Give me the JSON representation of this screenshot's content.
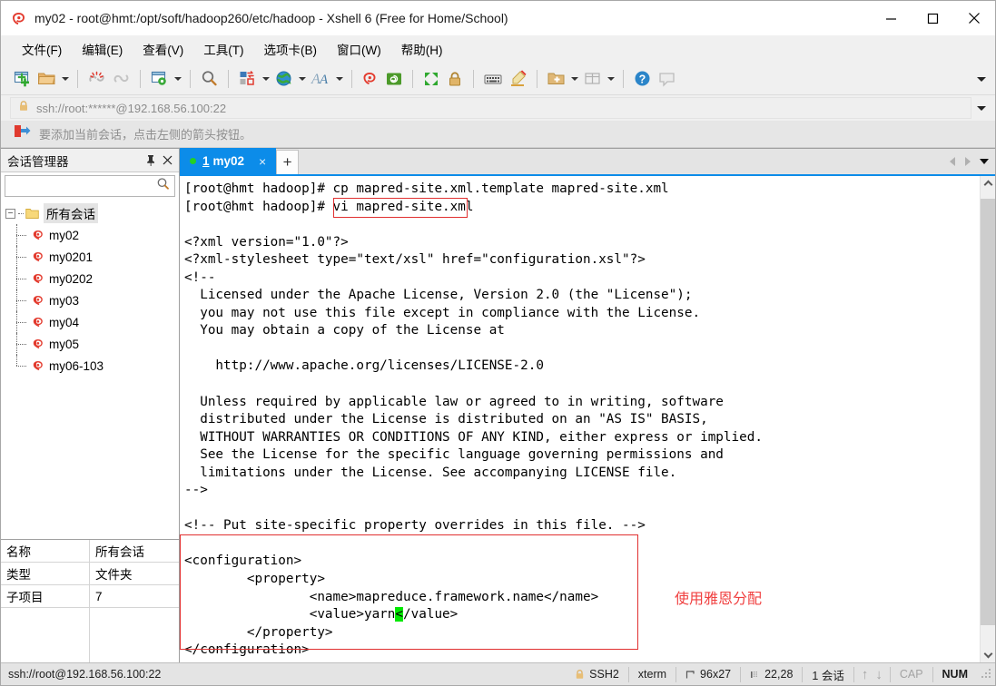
{
  "window": {
    "title": "my02 - root@hmt:/opt/soft/hadoop260/etc/hadoop - Xshell 6 (Free for Home/School)",
    "app_icon": "xshell-logo-icon",
    "minimize_label": "Minimize",
    "maximize_label": "Maximize",
    "close_label": "Close"
  },
  "menubar": {
    "items": [
      {
        "label": "文件(F)"
      },
      {
        "label": "编辑(E)"
      },
      {
        "label": "查看(V)"
      },
      {
        "label": "工具(T)"
      },
      {
        "label": "选项卡(B)"
      },
      {
        "label": "窗口(W)"
      },
      {
        "label": "帮助(H)"
      }
    ]
  },
  "toolbar": {
    "overflow_label": "More toolbar buttons",
    "items": [
      {
        "name": "new-session-icon",
        "caret": false
      },
      {
        "name": "open-folder-icon",
        "caret": true
      },
      {
        "name": "disconnect-icon",
        "caret": false
      },
      {
        "name": "reconnect-icon",
        "caret": false
      },
      {
        "name": "session-properties-icon",
        "caret": true
      },
      {
        "name": "find-icon",
        "caret": false
      },
      {
        "name": "transfer-file-icon",
        "caret": true
      },
      {
        "name": "globe-icon",
        "caret": true
      },
      {
        "name": "font-icon",
        "caret": true
      },
      {
        "name": "xshell-icon",
        "caret": false
      },
      {
        "name": "xftp-icon",
        "caret": false
      },
      {
        "name": "fullscreen-icon",
        "caret": false
      },
      {
        "name": "lock-icon",
        "caret": false
      },
      {
        "name": "keyboard-icon",
        "caret": false
      },
      {
        "name": "highlight-icon",
        "caret": false
      },
      {
        "name": "add-folder-icon",
        "caret": true
      },
      {
        "name": "layout-icon",
        "caret": true
      },
      {
        "name": "help-icon",
        "caret": false
      },
      {
        "name": "chat-icon",
        "caret": false
      }
    ]
  },
  "address_bar": {
    "lock_icon": "lock-icon",
    "value": "ssh://root:******@192.168.56.100:22",
    "placeholder": "ssh://",
    "dropdown_label": "Address history"
  },
  "notice_bar": {
    "icon": "red-arrow-icon",
    "text": "要添加当前会话，点击左侧的箭头按钮。"
  },
  "session_manager": {
    "title": "会话管理器",
    "pin_label": "固定",
    "close_label": "关闭",
    "search": {
      "value": "",
      "placeholder": "",
      "icon": "search-icon"
    },
    "root": {
      "label": "所有会话",
      "icon": "folder-icon",
      "expander": "−"
    },
    "sessions": [
      {
        "label": "my02",
        "icon": "xshell-session-icon"
      },
      {
        "label": "my0201",
        "icon": "xshell-session-icon"
      },
      {
        "label": "my0202",
        "icon": "xshell-session-icon"
      },
      {
        "label": "my03",
        "icon": "xshell-session-icon"
      },
      {
        "label": "my04",
        "icon": "xshell-session-icon"
      },
      {
        "label": "my05",
        "icon": "xshell-session-icon"
      },
      {
        "label": "my06-103",
        "icon": "xshell-session-icon"
      }
    ],
    "properties": [
      {
        "key": "名称",
        "value": "所有会话"
      },
      {
        "key": "类型",
        "value": "文件夹"
      },
      {
        "key": "子项目",
        "value": "7"
      }
    ]
  },
  "tabbar": {
    "tabs": [
      {
        "number": "1",
        "label": "my02",
        "status": "connected",
        "close_label": "×"
      }
    ],
    "new_tab_label": "+",
    "nav_prev_label": "上一个选项卡",
    "nav_next_label": "下一个选项卡",
    "nav_menu_label": "选项卡列表"
  },
  "terminal": {
    "lines": [
      "[root@hmt hadoop]# cp mapred-site.xml.template mapred-site.xml",
      "[root@hmt hadoop]# vi mapred-site.xml",
      "",
      "<?xml version=\"1.0\"?>",
      "<?xml-stylesheet type=\"text/xsl\" href=\"configuration.xsl\"?>",
      "<!--",
      "  Licensed under the Apache License, Version 2.0 (the \"License\");",
      "  you may not use this file except in compliance with the License.",
      "  You may obtain a copy of the License at",
      "",
      "    http://www.apache.org/licenses/LICENSE-2.0",
      "",
      "  Unless required by applicable law or agreed to in writing, software",
      "  distributed under the License is distributed on an \"AS IS\" BASIS,",
      "  WITHOUT WARRANTIES OR CONDITIONS OF ANY KIND, either express or implied.",
      "  See the License for the specific language governing permissions and",
      "  limitations under the License. See accompanying LICENSE file.",
      "-->",
      "",
      "<!-- Put site-specific property overrides in this file. -->",
      "",
      "<configuration>",
      "        <property>",
      "                <name>mapreduce.framework.name</name>",
      "                <value>yarn</value>",
      "        </property>",
      "</configuration>"
    ],
    "cursor_line_prefix": "                <value>yarn",
    "cursor_char": "<",
    "cursor_line_suffix": "/value>",
    "annotation_text": "使用雅恩分配",
    "annotation_color": "#f04040",
    "highlight_box_color": "#e03030",
    "cursor_color": "#00e800"
  },
  "scrollbar": {
    "up_label": "向上滚动",
    "down_label": "向下滚动"
  },
  "statusbar": {
    "url": "ssh://root@192.168.56.100:22",
    "protocol": "SSH2",
    "protocol_icon": "lock-icon",
    "terminal_type": "xterm",
    "size_icon": "size-icon",
    "size": "96x27",
    "cursor_icon": "cursor-icon",
    "cursor_pos": "22,28",
    "sessions": "1 会话",
    "up_arrow": "↑",
    "down_arrow": "↓",
    "caps": "CAP",
    "num": "NUM"
  }
}
